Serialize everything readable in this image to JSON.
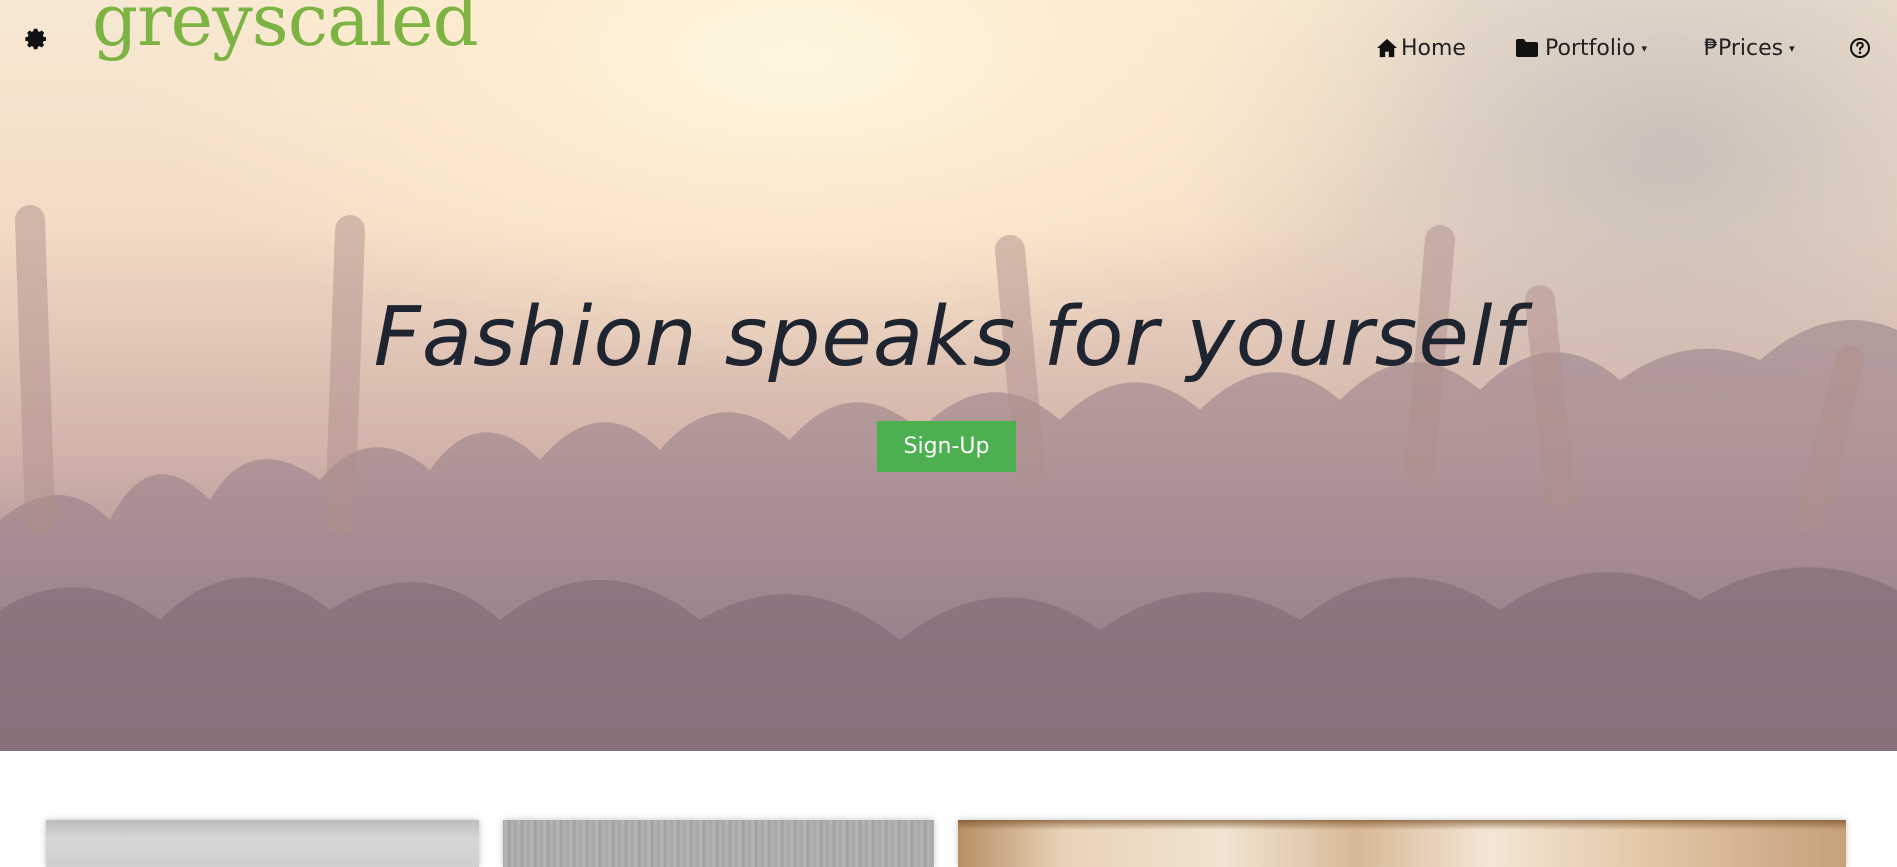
{
  "header": {
    "logo_text": "greyscaled",
    "logo_color": "#7cb342",
    "settings_icon": "gear-icon",
    "nav": {
      "home": {
        "label": "Home",
        "icon": "home-icon"
      },
      "portfolio": {
        "label": "Portfolio",
        "icon": "folder-icon",
        "caret": "▾"
      },
      "prices": {
        "label": "₱Prices",
        "caret": "▾"
      },
      "help": {
        "icon": "help-circle-icon"
      }
    }
  },
  "hero": {
    "headline": "Fashion speaks for yourself",
    "signup_label": "Sign-Up",
    "signup_color": "#4caf50"
  },
  "cards": [
    {
      "name": "feature-card-grey"
    },
    {
      "name": "feature-card-wood-grey"
    },
    {
      "name": "feature-card-wood"
    }
  ]
}
